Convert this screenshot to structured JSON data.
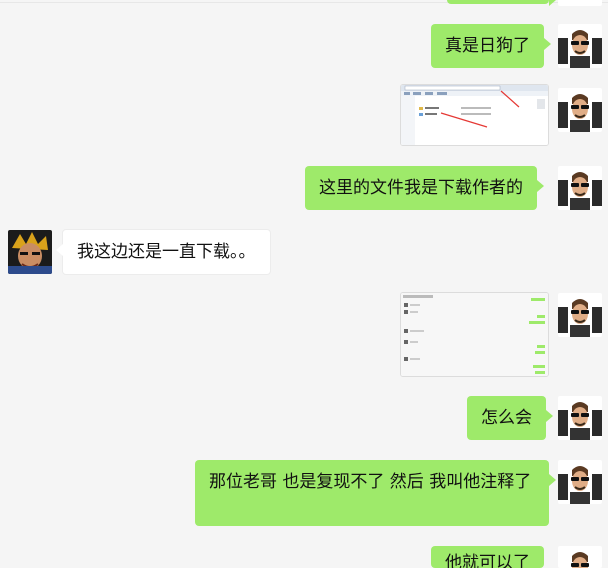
{
  "messages": [
    {
      "side": "out",
      "type": "text",
      "text": ""
    },
    {
      "side": "out",
      "type": "text",
      "text": "真是日狗了"
    },
    {
      "side": "out",
      "type": "image",
      "alt": "file-explorer-screenshot"
    },
    {
      "side": "out",
      "type": "text",
      "text": "这里的文件我是下载作者的"
    },
    {
      "side": "in",
      "type": "text",
      "text": "我这边还是一直下载。。"
    },
    {
      "side": "out",
      "type": "image",
      "alt": "chat-screenshot"
    },
    {
      "side": "out",
      "type": "text",
      "text": "怎么会"
    },
    {
      "side": "out",
      "type": "text",
      "text": "那位老哥 也是复现不了  然后 我叫他注释了"
    },
    {
      "side": "out",
      "type": "text",
      "text": "他就可以了"
    }
  ],
  "colors": {
    "background": "#f5f5f5",
    "outgoing_bubble": "#9eea6a",
    "incoming_bubble": "#ffffff"
  }
}
